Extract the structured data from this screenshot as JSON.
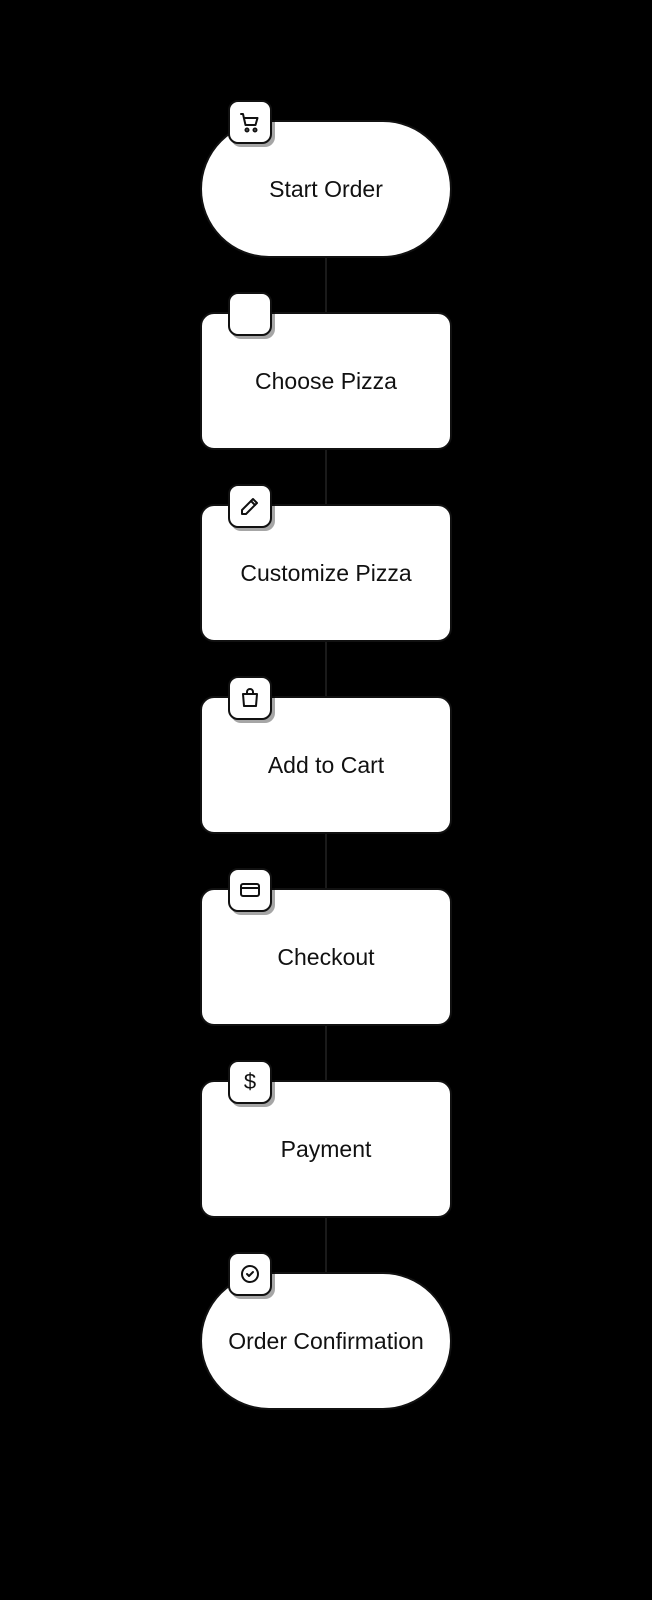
{
  "flow": {
    "nodes": [
      {
        "id": "start-order",
        "label": "Start Order",
        "shape": "pill",
        "icon": "cart-icon"
      },
      {
        "id": "choose-pizza",
        "label": "Choose Pizza",
        "shape": "rect",
        "icon": "blank-icon"
      },
      {
        "id": "customize-pizza",
        "label": "Customize Pizza",
        "shape": "rect",
        "icon": "edit-icon"
      },
      {
        "id": "add-to-cart",
        "label": "Add to Cart",
        "shape": "rect",
        "icon": "bag-icon"
      },
      {
        "id": "checkout",
        "label": "Checkout",
        "shape": "rect",
        "icon": "card-icon"
      },
      {
        "id": "payment",
        "label": "Payment",
        "shape": "rect",
        "icon": "dollar-icon"
      },
      {
        "id": "order-confirmation",
        "label": "Order Confirmation",
        "shape": "pill",
        "icon": "check-icon"
      }
    ]
  },
  "chart_data": {
    "type": "flowchart",
    "direction": "top-to-bottom",
    "nodes": [
      {
        "id": "start-order",
        "label": "Start Order",
        "shape": "terminator",
        "icon": "shopping-cart"
      },
      {
        "id": "choose-pizza",
        "label": "Choose Pizza",
        "shape": "process",
        "icon": "blank"
      },
      {
        "id": "customize-pizza",
        "label": "Customize Pizza",
        "shape": "process",
        "icon": "edit"
      },
      {
        "id": "add-to-cart",
        "label": "Add to Cart",
        "shape": "process",
        "icon": "shopping-bag"
      },
      {
        "id": "checkout",
        "label": "Checkout",
        "shape": "process",
        "icon": "credit-card"
      },
      {
        "id": "payment",
        "label": "Payment",
        "shape": "process",
        "icon": "dollar"
      },
      {
        "id": "order-confirmation",
        "label": "Order Confirmation",
        "shape": "terminator",
        "icon": "check-circle"
      }
    ],
    "edges": [
      {
        "from": "start-order",
        "to": "choose-pizza"
      },
      {
        "from": "choose-pizza",
        "to": "customize-pizza"
      },
      {
        "from": "customize-pizza",
        "to": "add-to-cart"
      },
      {
        "from": "add-to-cart",
        "to": "checkout"
      },
      {
        "from": "checkout",
        "to": "payment"
      },
      {
        "from": "payment",
        "to": "order-confirmation"
      }
    ],
    "style": "hand-drawn",
    "background": "#000000",
    "node_fill": "#ffffff",
    "node_stroke": "#111111"
  }
}
